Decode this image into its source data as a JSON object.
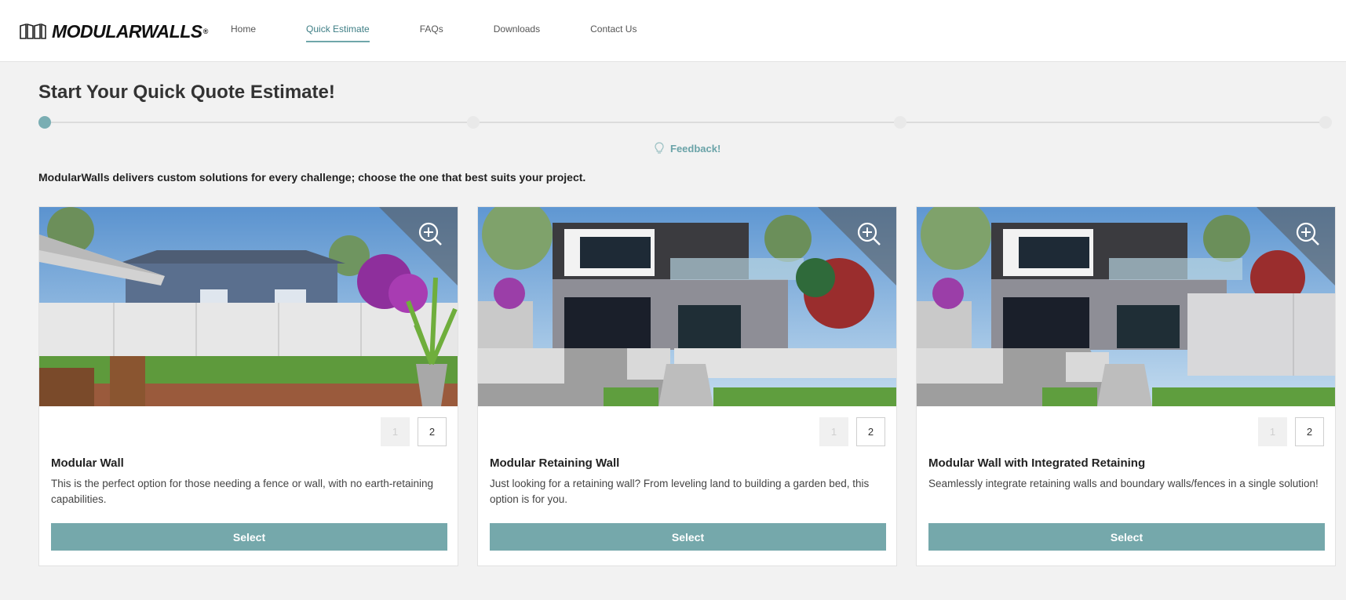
{
  "header": {
    "logo_text": "MODULARWALLS",
    "logo_mark": "®",
    "nav": [
      "Home",
      "Quick Estimate",
      "FAQs",
      "Downloads",
      "Contact Us"
    ],
    "active_nav": "Quick Estimate"
  },
  "page": {
    "title": "Start Your Quick Quote Estimate!",
    "progress_steps": 3,
    "progress_current": 1,
    "feedback_label": "Feedback!",
    "intro": "ModularWalls delivers custom solutions for every challenge; choose the one that best suits your project."
  },
  "cards": [
    {
      "title": "Modular Wall",
      "description": "This is the perfect option for those needing a fence or wall, with no earth-retaining capabilities.",
      "pages": [
        "1",
        "2"
      ],
      "select_label": "Select"
    },
    {
      "title": "Modular Retaining Wall",
      "description": "Just looking for a retaining wall? From leveling land to building a garden bed, this option is for you.",
      "pages": [
        "1",
        "2"
      ],
      "select_label": "Select"
    },
    {
      "title": "Modular Wall with Integrated Retaining",
      "description": "Seamlessly integrate retaining walls and boundary walls/fences in a single solution!",
      "pages": [
        "1",
        "2"
      ],
      "select_label": "Select"
    }
  ],
  "colors": {
    "accent": "#75a8ab",
    "progress_active": "#7aaeb3",
    "nav_active": "#3f7f86"
  },
  "icons": {
    "logo": "wall-panels-icon",
    "feedback": "lightbulb-icon",
    "zoom": "zoom-in-icon"
  }
}
